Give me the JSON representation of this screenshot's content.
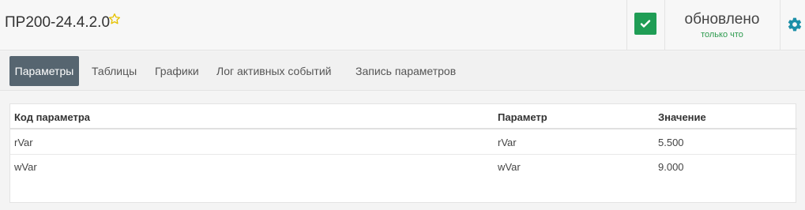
{
  "header": {
    "device_title": "ПР200-24.4.2.0",
    "status": "обновлено",
    "status_time": "только что"
  },
  "tabs": [
    {
      "label": "Параметры",
      "active": true
    },
    {
      "label": "Таблицы",
      "active": false
    },
    {
      "label": "Графики",
      "active": false
    },
    {
      "label": "Лог активных событий",
      "active": false
    },
    {
      "label": "Запись параметров",
      "active": false
    }
  ],
  "table": {
    "headers": [
      "Код параметра",
      "Параметр",
      "Значение"
    ],
    "rows": [
      [
        "rVar",
        "rVar",
        "5.500"
      ],
      [
        "wVar",
        "wVar",
        "9.000"
      ]
    ]
  },
  "colors": {
    "accent_active_tab": "#566570",
    "status_ok": "#1f9d55",
    "gear": "#1c8fa8",
    "star": "#e6c200"
  }
}
